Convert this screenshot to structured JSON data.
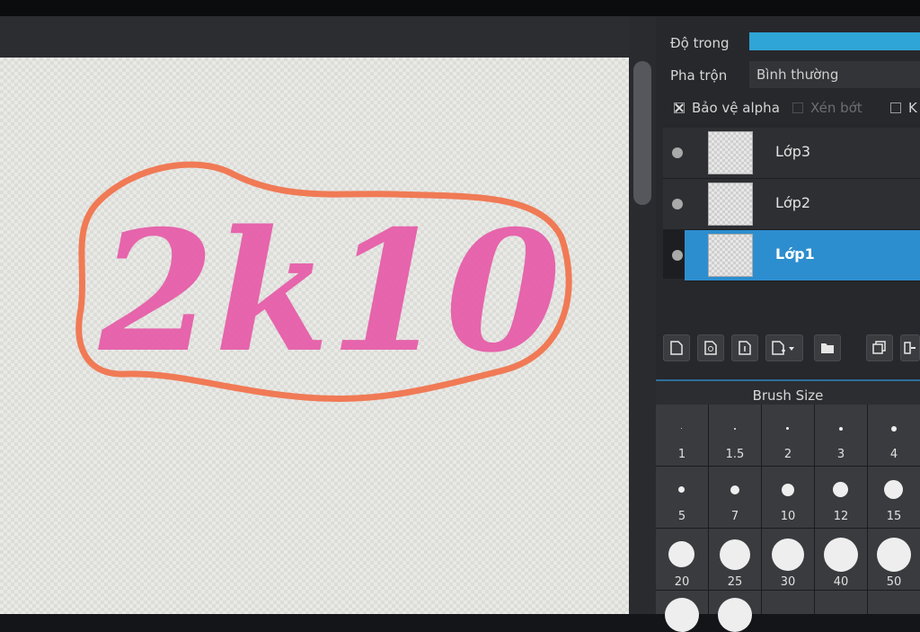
{
  "panel": {
    "opacity_label": "Độ trong",
    "blend_label": "Pha trộn",
    "blend_value": "Bình thường",
    "checks": {
      "protect_alpha": {
        "label": "Bảo vệ alpha",
        "checked": true
      },
      "clipping": {
        "label": "Xén bớt",
        "checked": false
      },
      "lock": {
        "label": "K",
        "checked": false
      }
    },
    "accent_color": "#2fa4d6"
  },
  "layers": [
    {
      "name": "Lớp3",
      "selected": false
    },
    {
      "name": "Lớp2",
      "selected": false
    },
    {
      "name": "Lớp1",
      "selected": true
    }
  ],
  "brush": {
    "title": "Brush Size",
    "sizes": [
      "1",
      "1.5",
      "2",
      "3",
      "4",
      "5",
      "7",
      "10",
      "12",
      "15",
      "20",
      "25",
      "30",
      "40",
      "50"
    ]
  },
  "canvas": {
    "drawing_text": "2k10",
    "outline_color": "#f07a55",
    "text_color": "#e65aa8"
  }
}
